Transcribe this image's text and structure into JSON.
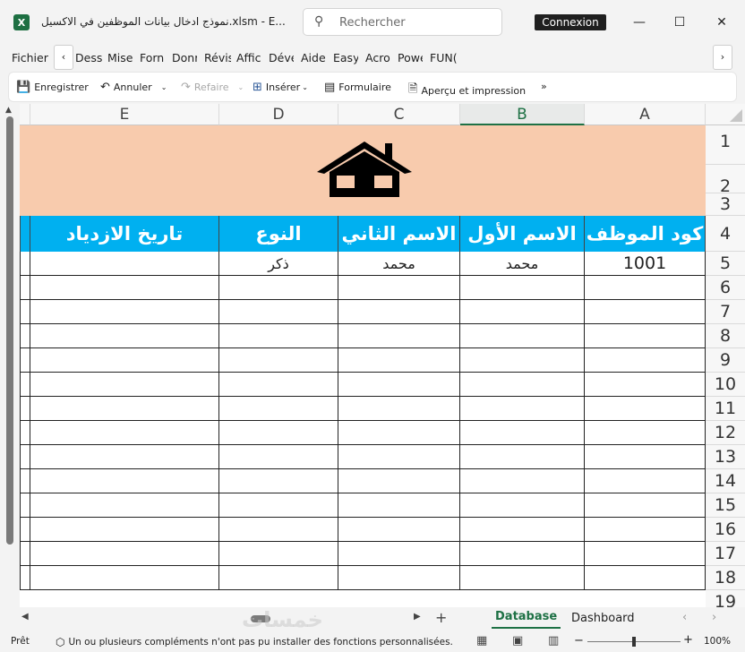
{
  "window": {
    "title": "نموذج ادخال بيانات الموظفين في الاكسيل.xlsm  -  E...",
    "search_placeholder": "Rechercher",
    "connexion_label": "Connexion",
    "minimize_glyph": "—",
    "maximize_glyph": "☐",
    "close_glyph": "✕"
  },
  "ribbon": {
    "file_tab": "Fichier",
    "tabs": [
      "Dess",
      "Mise",
      "Forn",
      "Donr",
      "Révis",
      "Afficl",
      "Déve",
      "Aide",
      "Easy",
      "Acro",
      "Powe",
      "FUN("
    ],
    "scroll_left": "‹",
    "scroll_right": "›"
  },
  "toolbar": {
    "save": "Enregistrer",
    "undo": "Annuler",
    "redo": "Refaire",
    "insert": "Insérer",
    "form": "Formulaire",
    "preview": "Aperçu et impression",
    "more": "»"
  },
  "grid": {
    "columns": [
      "E",
      "D",
      "C",
      "B",
      "A"
    ],
    "selected_column": "B",
    "row_numbers": [
      "1",
      "2",
      "3",
      "4",
      "5",
      "6",
      "7",
      "8",
      "9",
      "10",
      "11",
      "12",
      "13",
      "14",
      "15",
      "16",
      "17",
      "18",
      "19"
    ],
    "headers": {
      "birth_date": "تاريخ الازدياد",
      "gender": "النوع",
      "second_name": "الاسم الثاني",
      "first_name": "الاسم الأول",
      "employee_code": "كود الموظف"
    },
    "first_record": {
      "birth_date": "",
      "gender": "ذكر",
      "second_name": "محمد",
      "first_name": "محمد",
      "employee_code": "1001"
    }
  },
  "sheets": {
    "tabs": [
      "Database",
      "Dashboard"
    ],
    "active": "Database",
    "add": "+",
    "watermark": "خمسات"
  },
  "status": {
    "ready": "Prêt",
    "message": "Un ou plusieurs compléments n'ont pas pu installer des fonctions personnalisées.",
    "zoom": "100%",
    "zoom_minus": "−",
    "zoom_plus": "+"
  },
  "colors": {
    "banner": "#f8cbad",
    "header_fill": "#00b0f0",
    "excel_green": "#1e7145"
  }
}
